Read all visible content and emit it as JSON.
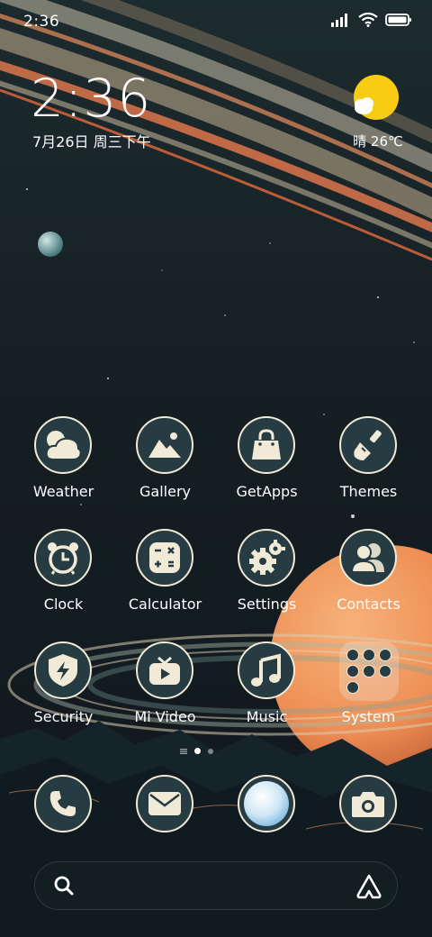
{
  "status_bar": {
    "time": "2:36",
    "icons": [
      "signal-icon",
      "wifi-icon",
      "battery-icon"
    ]
  },
  "clock_widget": {
    "time": "2:36",
    "date": "7月26日 周三下午"
  },
  "weather_widget": {
    "icon": "sun-cloud-icon",
    "text": "晴 26℃"
  },
  "apps": [
    {
      "label": "Weather",
      "icon": "cloud-icon"
    },
    {
      "label": "Gallery",
      "icon": "mountain-icon"
    },
    {
      "label": "GetApps",
      "icon": "shopping-bag-icon"
    },
    {
      "label": "Themes",
      "icon": "paint-brush-icon"
    },
    {
      "label": "Clock",
      "icon": "alarm-clock-icon"
    },
    {
      "label": "Calculator",
      "icon": "calculator-icon"
    },
    {
      "label": "Settings",
      "icon": "gears-icon"
    },
    {
      "label": "Contacts",
      "icon": "people-icon"
    },
    {
      "label": "Security",
      "icon": "shield-bolt-icon"
    },
    {
      "label": "Mi Video",
      "icon": "tv-play-icon"
    },
    {
      "label": "Music",
      "icon": "music-note-icon"
    },
    {
      "label": "System",
      "icon": "folder-icon"
    }
  ],
  "page_indicator": {
    "pages": 3,
    "active": 2
  },
  "dock": [
    {
      "name": "phone",
      "icon": "phone-icon"
    },
    {
      "name": "messages",
      "icon": "envelope-icon"
    },
    {
      "name": "browser",
      "icon": "browser-bubble-icon"
    },
    {
      "name": "camera",
      "icon": "camera-icon"
    }
  ],
  "search_bar": {
    "left_icon": "search-icon",
    "right_icon": "assistant-icon"
  },
  "colors": {
    "icon_fill": "#263b42",
    "icon_outline": "#f1ead7",
    "ring_orange": "#e97a4f",
    "planet": "#f29a5c",
    "sun": "#f7cc12"
  }
}
